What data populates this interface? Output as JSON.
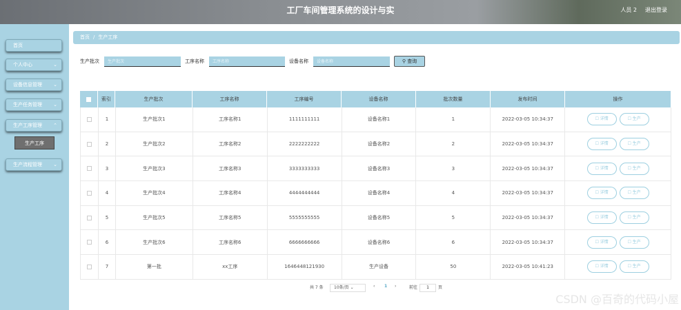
{
  "header": {
    "title": "工厂车间管理系统的设计与实",
    "user": "人员 2",
    "logout": "退出登录"
  },
  "sidebar": {
    "items": [
      {
        "label": "首页",
        "chev": ""
      },
      {
        "label": "个人中心",
        "chev": "⌄"
      },
      {
        "label": "设备信息管理",
        "chev": "⌄"
      },
      {
        "label": "生产任务管理",
        "chev": "⌄"
      },
      {
        "label": "生产工序管理",
        "chev": "⌃"
      },
      {
        "label": "生产流程管理",
        "chev": "⌄"
      }
    ],
    "sub_item": "生产工序"
  },
  "breadcrumb": {
    "home": "首页",
    "sep": "/",
    "current": "生产工序"
  },
  "filters": {
    "batch_label": "生产批次",
    "batch_placeholder": "生产批次",
    "process_label": "工序名称",
    "process_placeholder": "工序名称",
    "device_label": "设备名称",
    "device_placeholder": "设备名称",
    "query_label": "查询",
    "search_icon": "search-icon"
  },
  "table": {
    "headers": [
      "索引",
      "生产批次",
      "工序名称",
      "工序编号",
      "设备名称",
      "批次数量",
      "发布时间",
      "操作"
    ],
    "detail_label": "详情",
    "produce_label": "生产",
    "rows": [
      {
        "index": "1",
        "batch": "生产批次1",
        "process": "工序名称1",
        "code": "1111111111",
        "device": "设备名称1",
        "qty": "1",
        "time": "2022-03-05 10:34:37"
      },
      {
        "index": "2",
        "batch": "生产批次2",
        "process": "工序名称2",
        "code": "2222222222",
        "device": "设备名称2",
        "qty": "2",
        "time": "2022-03-05 10:34:37"
      },
      {
        "index": "3",
        "batch": "生产批次3",
        "process": "工序名称3",
        "code": "3333333333",
        "device": "设备名称3",
        "qty": "3",
        "time": "2022-03-05 10:34:37"
      },
      {
        "index": "4",
        "batch": "生产批次4",
        "process": "工序名称4",
        "code": "4444444444",
        "device": "设备名称4",
        "qty": "4",
        "time": "2022-03-05 10:34:37"
      },
      {
        "index": "5",
        "batch": "生产批次5",
        "process": "工序名称5",
        "code": "5555555555",
        "device": "设备名称5",
        "qty": "5",
        "time": "2022-03-05 10:34:37"
      },
      {
        "index": "6",
        "batch": "生产批次6",
        "process": "工序名称6",
        "code": "6666666666",
        "device": "设备名称6",
        "qty": "6",
        "time": "2022-03-05 10:34:37"
      },
      {
        "index": "7",
        "batch": "第一批",
        "process": "xx工序",
        "code": "1646448121930",
        "device": "生产设备",
        "qty": "50",
        "time": "2022-03-05 10:41:23"
      }
    ]
  },
  "pager": {
    "total": "共 7 条",
    "page_size": "10条/页",
    "prev": "‹",
    "page": "1",
    "next": "›",
    "goto": "前往",
    "goto_value": "1",
    "page_unit": "页"
  },
  "watermark": "CSDN @百奇的代码小屋",
  "colors": {
    "accent": "#a9d3e3",
    "submenu_active": "#6f6f6f"
  }
}
